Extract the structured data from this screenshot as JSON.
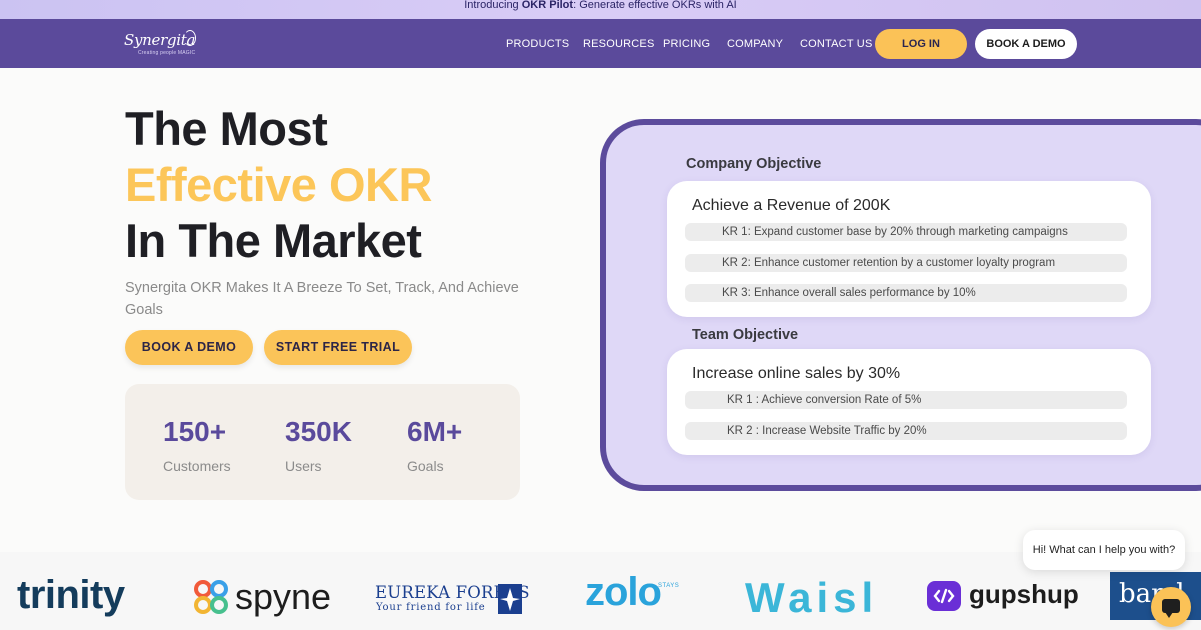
{
  "announcement": {
    "prefix": "Introducing ",
    "bold": "OKR Pilot",
    "suffix": ": Generate effective OKRs with AI"
  },
  "nav": {
    "logo_word": "Synergita",
    "logo_tag": "Creating people MAGIC",
    "menu": [
      "PRODUCTS",
      "RESOURCES",
      "PRICING",
      "COMPANY",
      "CONTACT US"
    ],
    "login": "LOG IN",
    "book_demo": "BOOK A DEMO"
  },
  "hero": {
    "line1": "The Most",
    "line2": "Effective OKR",
    "line3": "In The Market",
    "subtitle": "Synergita OKR Makes It A Breeze To Set, Track, And Achieve Goals",
    "cta_demo": "BOOK A DEMO",
    "cta_trial": "START FREE TRIAL"
  },
  "stats": [
    {
      "value": "150+",
      "label": "Customers"
    },
    {
      "value": "350K",
      "label": "Users"
    },
    {
      "value": "6M+",
      "label": "Goals"
    }
  ],
  "okr_panel": {
    "company_heading": "Company Objective",
    "company_objective": "Achieve a Revenue of 200K",
    "company_krs": [
      "KR 1: Expand customer base by 20% through marketing campaigns",
      "KR 2: Enhance customer retention by a customer loyalty program",
      "KR 3: Enhance overall sales performance by 10%"
    ],
    "team_heading": "Team Objective",
    "team_objective": "Increase online sales by 30%",
    "team_krs": [
      "KR 1 : Achieve conversion Rate of 5%",
      "KR 2 : Increase Website Traffic by 20%"
    ]
  },
  "chat": {
    "greeting": "Hi! What can I help you with?",
    "icon": "chat-icon"
  },
  "client_logos": {
    "trinity": "trinity",
    "spyne": "spyne",
    "eureka_main": "EUREKA FORBES",
    "eureka_tag": "Your friend for life",
    "zolo": "zolo",
    "zolo_stays": "STAYS",
    "waisl": "Waisl",
    "gupshup": "gupshup",
    "bandhan": "band"
  },
  "colors": {
    "nav_bg": "#5b4a9b",
    "accent_yellow": "#fbc257",
    "stat_purple": "#5a4a9c",
    "panel_bg": "#dfd8f7"
  }
}
